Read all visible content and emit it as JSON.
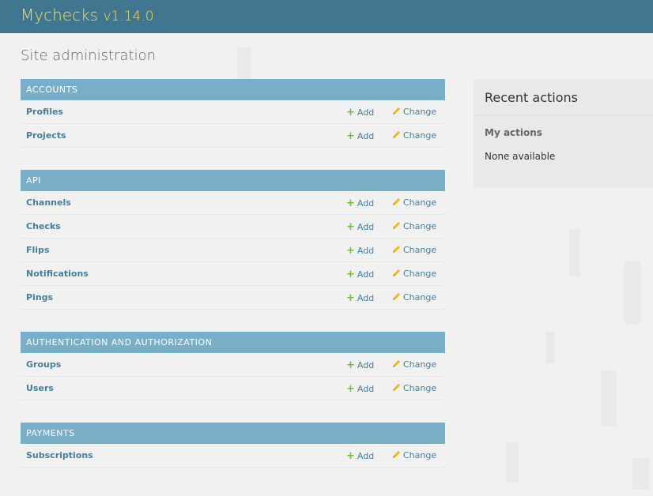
{
  "header": {
    "brand": "Mychecks",
    "version": "v1.14.0"
  },
  "page": {
    "title": "Site administration"
  },
  "modules": [
    {
      "caption": "ACCOUNTS",
      "models": [
        {
          "name": "Profiles",
          "add": "Add",
          "change": "Change"
        },
        {
          "name": "Projects",
          "add": "Add",
          "change": "Change"
        }
      ]
    },
    {
      "caption": "API",
      "models": [
        {
          "name": "Channels",
          "add": "Add",
          "change": "Change"
        },
        {
          "name": "Checks",
          "add": "Add",
          "change": "Change"
        },
        {
          "name": "Flips",
          "add": "Add",
          "change": "Change"
        },
        {
          "name": "Notifications",
          "add": "Add",
          "change": "Change"
        },
        {
          "name": "Pings",
          "add": "Add",
          "change": "Change"
        }
      ]
    },
    {
      "caption": "AUTHENTICATION AND AUTHORIZATION",
      "models": [
        {
          "name": "Groups",
          "add": "Add",
          "change": "Change"
        },
        {
          "name": "Users",
          "add": "Add",
          "change": "Change"
        }
      ]
    },
    {
      "caption": "PAYMENTS",
      "models": [
        {
          "name": "Subscriptions",
          "add": "Add",
          "change": "Change"
        }
      ]
    }
  ],
  "recent_actions": {
    "title": "Recent actions",
    "subtitle": "My actions",
    "empty_text": "None available"
  },
  "colors": {
    "header_bg": "#417690",
    "brand_text": "#f5dd5d",
    "caption_bg": "#79aec8",
    "link": "#447e9b",
    "add_icon": "#70bf2b",
    "change_icon": "#efb80b"
  },
  "icons": {
    "add": "plus-icon",
    "change": "pencil-icon"
  }
}
